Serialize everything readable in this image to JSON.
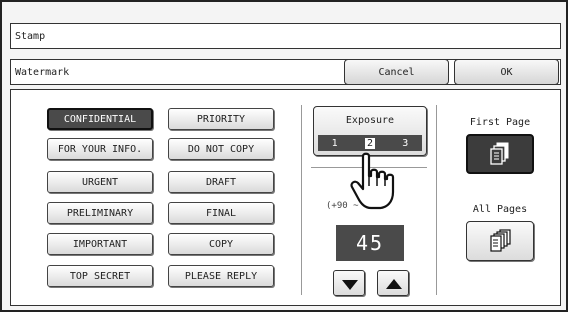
{
  "title": "Stamp",
  "subtitle": "Watermark",
  "buttons": {
    "cancel": "Cancel",
    "ok": "OK"
  },
  "stamps": {
    "left": [
      "CONFIDENTIAL",
      "FOR YOUR INFO.",
      "URGENT",
      "PRELIMINARY",
      "IMPORTANT",
      "TOP SECRET"
    ],
    "right": [
      "PRIORITY",
      "DO NOT COPY",
      "DRAFT",
      "FINAL",
      "COPY",
      "PLEASE REPLY"
    ],
    "selected": "CONFIDENTIAL"
  },
  "exposure": {
    "label": "Exposure",
    "levels": [
      "1",
      "2",
      "3"
    ],
    "selected_level": "2"
  },
  "range_text": "(+90 ~ -90)",
  "value": "45",
  "pages": {
    "first_page_label": "First Page",
    "all_pages_label": "All Pages",
    "selected": "First Page"
  },
  "colors": {
    "selected_fill": "#4a4a4a",
    "button_fill": "#e6e6e6"
  }
}
